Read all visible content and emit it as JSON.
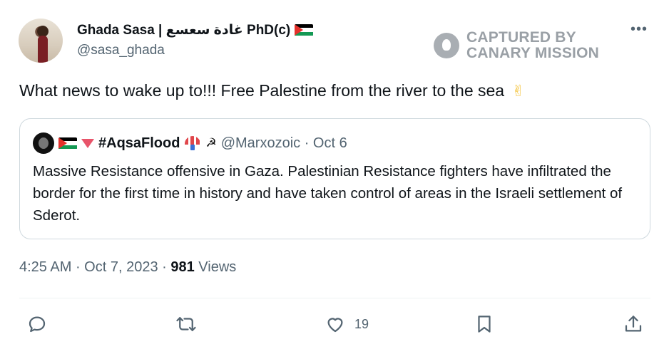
{
  "author": {
    "display_name": "Ghada Sasa | غادة سعسع PhD(c)",
    "handle": "@sasa_ghada"
  },
  "watermark": {
    "line1": "CAPTURED BY",
    "line2": "CANARY MISSION"
  },
  "more_label": "•••",
  "tweet": {
    "text": "What news to wake up to!!! Free Palestine from the river to the sea",
    "emoji": "✌"
  },
  "quote": {
    "name": "#AqsaFlood",
    "sickle": "☭",
    "handle_date": "@Marxozoic · Oct 6",
    "text": "Massive Resistance offensive in Gaza. Palestinian Resistance fighters have infiltrated the border for the first time in history and have taken control of areas in the Israeli settlement of Sderot."
  },
  "meta": {
    "time": "4:25 AM",
    "date": "Oct 7, 2023",
    "views_count": "981",
    "views_label": "Views"
  },
  "actions": {
    "reply_icon": "reply-icon",
    "retweet_icon": "retweet-icon",
    "like_icon": "heart-icon",
    "like_count": "19",
    "bookmark_icon": "bookmark-icon",
    "share_icon": "share-icon"
  },
  "colors": {
    "text": "#0f1419",
    "secondary": "#536471",
    "border": "#cfd9de",
    "flag_red": "#e4312b",
    "flag_green": "#149954"
  }
}
